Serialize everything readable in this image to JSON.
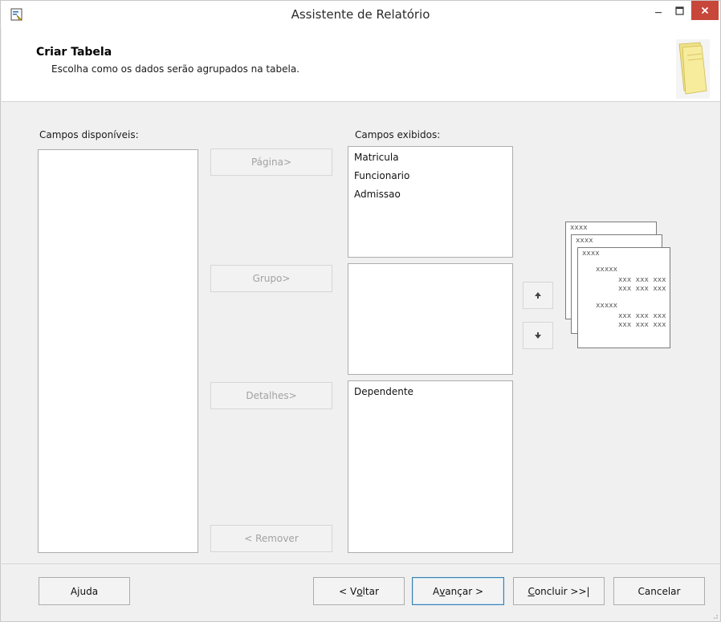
{
  "window": {
    "title": "Assistente de Relatório"
  },
  "header": {
    "title": "Criar Tabela",
    "subtitle": "Escolha como os dados serão agrupados na tabela."
  },
  "available": {
    "label": "Campos disponíveis:",
    "items": []
  },
  "displayed": {
    "label": "Campos exibidos:",
    "page_items": [
      "Matricula",
      "Funcionario",
      "Admissao"
    ],
    "group_items": [],
    "detail_items": [
      "Dependente"
    ]
  },
  "actions": {
    "page": "Página>",
    "group": "Grupo>",
    "details": "Detalhes>",
    "remove": "< Remover"
  },
  "preview": {
    "header": "xxxx",
    "group": "xxxxx",
    "row": "xxx xxx xxx"
  },
  "footer": {
    "help_pre": "A",
    "help_u": "j",
    "help_post": "uda",
    "back_pre": "< V",
    "back_u": "o",
    "back_post": "ltar",
    "next_pre": "A",
    "next_u": "v",
    "next_post": "ançar >",
    "finish_pre": "",
    "finish_u": "C",
    "finish_post": "oncluir >>|",
    "cancel": "Cancelar"
  }
}
